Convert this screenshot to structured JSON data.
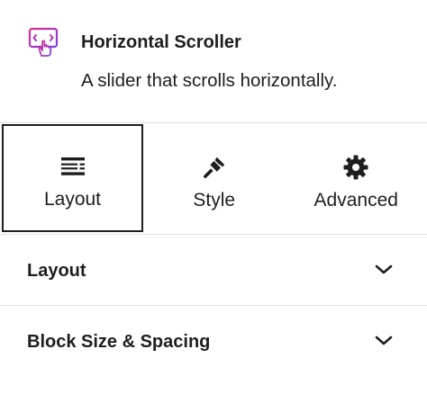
{
  "block": {
    "title": "Horizontal Scroller",
    "description": "A slider that scrolls horizontally.",
    "icon": "horizontal-scroller-icon",
    "icon_colors": [
      "#e02e8a",
      "#7b3fe4"
    ]
  },
  "tabs": [
    {
      "label": "Layout",
      "icon": "layout-icon",
      "active": true
    },
    {
      "label": "Style",
      "icon": "brush-icon",
      "active": false
    },
    {
      "label": "Advanced",
      "icon": "gear-icon",
      "active": false
    }
  ],
  "panels": [
    {
      "label": "Layout",
      "icon": "chevron-down-icon"
    },
    {
      "label": "Block Size & Spacing",
      "icon": "chevron-down-icon"
    }
  ],
  "colors": {
    "text": "#1e1e1e",
    "divider": "#e0e0e0",
    "active_border": "#1e1e1e"
  }
}
